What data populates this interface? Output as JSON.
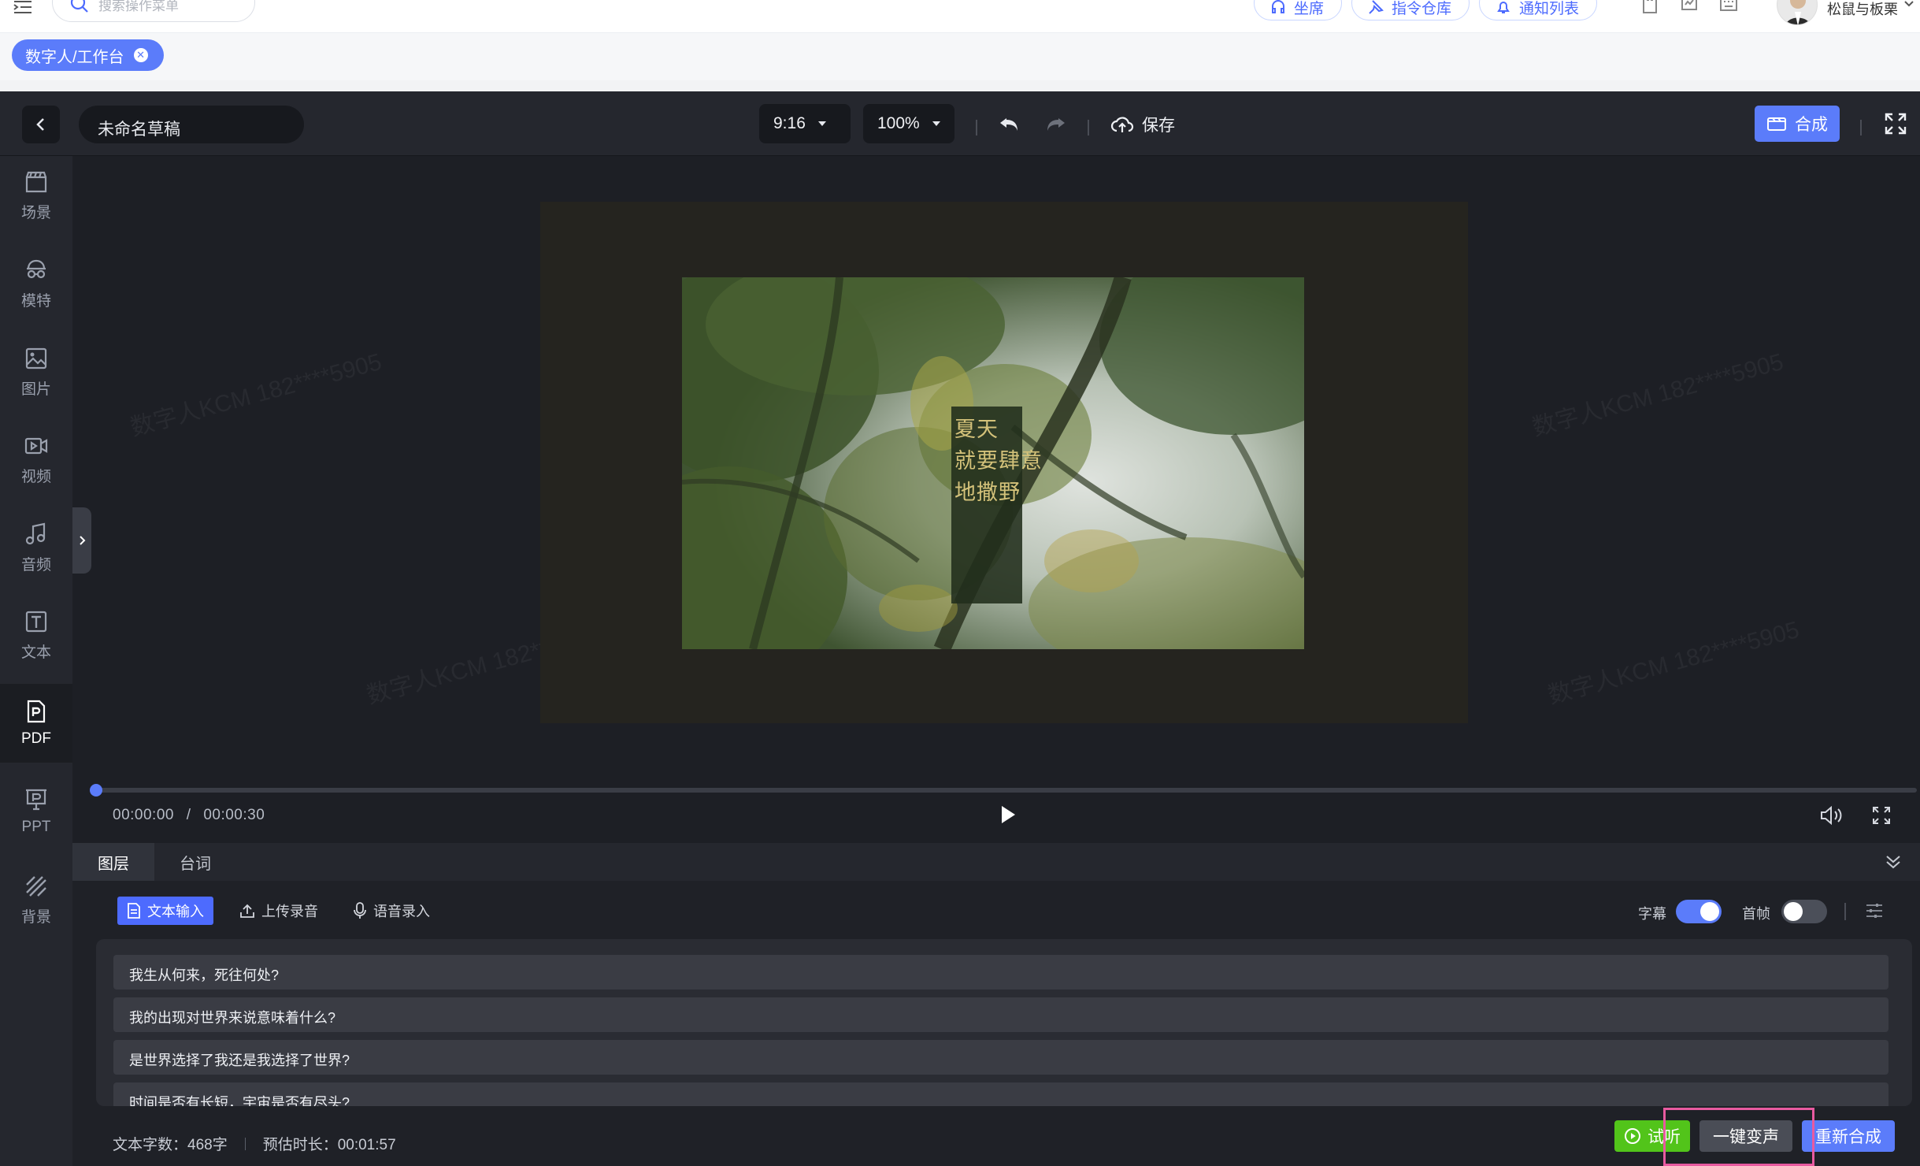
{
  "topbar": {
    "search_placeholder": "搜索操作菜单",
    "pills": [
      "坐席",
      "指令仓库",
      "通知列表"
    ],
    "user_name": "松鼠与板栗"
  },
  "breadcrumb": {
    "tag": "数字人/工作台"
  },
  "editor": {
    "draft_title": "未命名草稿",
    "ratio": "9:16",
    "zoom": "100%",
    "save_label": "保存",
    "compose_label": "合成"
  },
  "rail": [
    {
      "label": "场景",
      "icon": "clapperboard-icon"
    },
    {
      "label": "模特",
      "icon": "model-icon"
    },
    {
      "label": "图片",
      "icon": "image-icon"
    },
    {
      "label": "视频",
      "icon": "video-icon"
    },
    {
      "label": "音频",
      "icon": "music-icon"
    },
    {
      "label": "文本",
      "icon": "text-icon"
    },
    {
      "label": "PDF",
      "icon": "pdf-icon",
      "active": true
    },
    {
      "label": "PPT",
      "icon": "ppt-icon"
    },
    {
      "label": "背景",
      "icon": "background-icon"
    }
  ],
  "canvas": {
    "caption_lines": [
      "夏天",
      "就要肆意",
      "地撒野"
    ]
  },
  "player": {
    "current": "00:00:00",
    "separator": "/",
    "total": "00:00:30",
    "progress": 0
  },
  "panel": {
    "tabs": [
      "图层",
      "台词"
    ],
    "input_modes": [
      "文本输入",
      "上传录音",
      "语音录入"
    ],
    "subtitle_label": "字幕",
    "subtitle_on": true,
    "first_frame_label": "首帧",
    "first_frame_on": false,
    "script_lines": [
      "我生从何来，死往何处?",
      "我的出现对世界来说意味着什么?",
      "是世界选择了我还是我选择了世界?",
      "时间是否有长短，宇宙是否有尽头?"
    ],
    "word_count": "文本字数：468字",
    "est_duration": "预估时长：00:01:57",
    "listen_label": "试听",
    "voice_change_label": "一键变声",
    "recompose_label": "重新合成"
  },
  "colors": {
    "accent": "#5b7cfa",
    "listen": "#52c41a",
    "highlight": "#e85aa0"
  }
}
